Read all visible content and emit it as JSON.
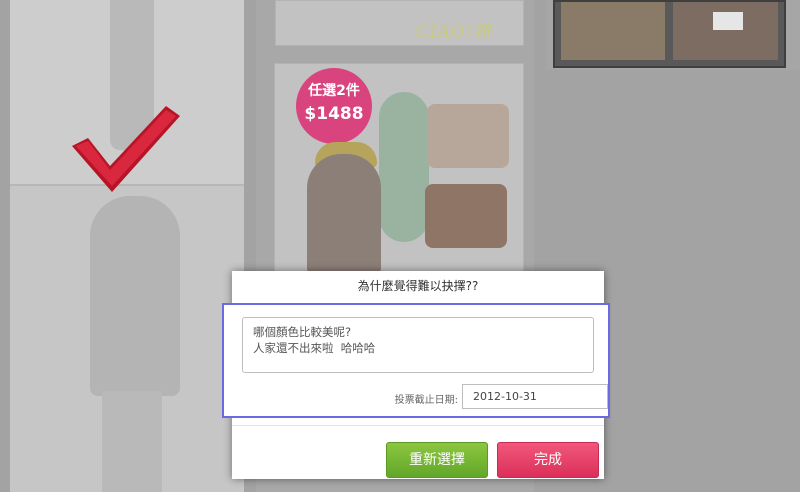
{
  "background": {
    "ad": {
      "promo_line1": "任選2件",
      "promo_line2": "$1488",
      "brand": "CIAO!妞"
    }
  },
  "dialog": {
    "title": "為什麼覺得難以抉擇??",
    "comment_lines": [
      "哪個顏色比較美呢?",
      "人家還不出來啦  哈哈哈"
    ],
    "deadline_label": "投票截止日期:",
    "deadline_value": "2012-10-31",
    "reselect_label": "重新選擇",
    "done_label": "完成"
  },
  "colors": {
    "reselect_button": "#7bb935",
    "done_button": "#e8456a",
    "focus_ring": "#6a6ae6",
    "check_mark": "#c0182c"
  },
  "icons": {
    "check": "check-mark-icon"
  }
}
